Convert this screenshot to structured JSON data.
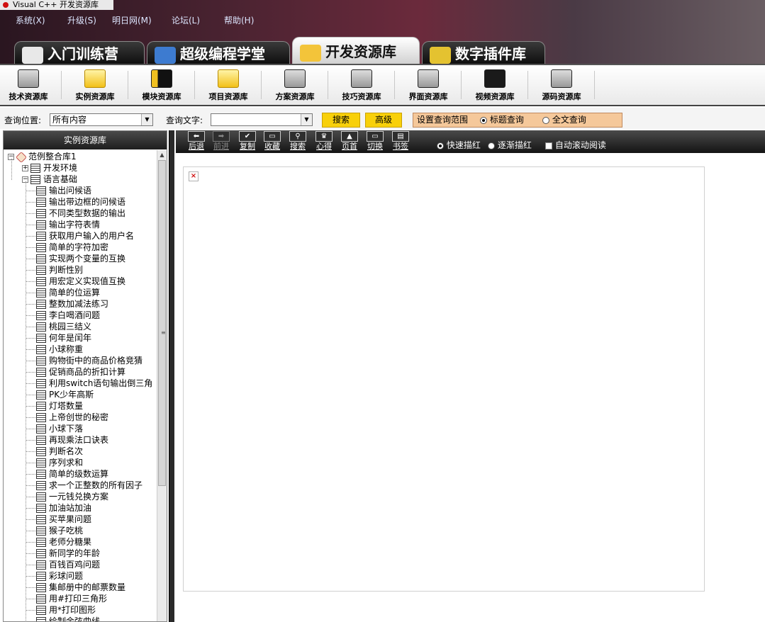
{
  "window": {
    "title": "Visual C++ 开发资源库"
  },
  "menu": [
    "系统(X)",
    "升级(S)",
    "明日网(M)",
    "论坛(L)",
    "帮助(H)"
  ],
  "big_tabs": [
    {
      "label": "入门训练营",
      "active": false
    },
    {
      "label": "超级编程学堂",
      "active": false
    },
    {
      "label": "开发资源库",
      "active": true
    },
    {
      "label": "数字插件库",
      "active": false
    }
  ],
  "libraries": [
    "技术资源库",
    "实例资源库",
    "模块资源库",
    "项目资源库",
    "方案资源库",
    "技巧资源库",
    "界面资源库",
    "视频资源库",
    "源码资源库"
  ],
  "query": {
    "location_label": "查询位置:",
    "location_value": "所有内容",
    "text_label": "查询文字:",
    "text_value": "",
    "search_button": "搜索",
    "advanced_button": "高级",
    "scope_label": "设置查询范围",
    "scope_title": "标题查询",
    "scope_full": "全文查询"
  },
  "left_panel": {
    "header": "实例资源库",
    "root": "范例整合库1",
    "folders": [
      "开发环境",
      "语言基础"
    ],
    "items": [
      "输出问候语",
      "输出带边框的问候语",
      "不同类型数据的输出",
      "输出字符表情",
      "获取用户输入的用户名",
      "简单的字符加密",
      "实现两个变量的互换",
      "判断性别",
      "用宏定义实现值互换",
      "简单的位运算",
      "整数加减法练习",
      "李白喝酒问题",
      "桃园三结义",
      "何年是闰年",
      "小球称重",
      "购物街中的商品价格竞猜",
      "促销商品的折扣计算",
      "利用switch语句输出倒三角",
      "PK少年高斯",
      "灯塔数量",
      "上帝创世的秘密",
      "小球下落",
      "再现乘法口诀表",
      "判断名次",
      "序列求和",
      "简单的级数运算",
      "求一个正整数的所有因子",
      "一元钱兑换方案",
      "加油站加油",
      "买苹果问题",
      "猴子吃桃",
      "老师分糖果",
      "新同学的年龄",
      "百钱百鸡问题",
      "彩球问题",
      "集邮册中的邮票数量",
      "用#打印三角形",
      "用*打印图形",
      "绘制余弦曲线"
    ]
  },
  "nav": {
    "buttons": [
      {
        "label": "后退",
        "icon": "back-arrow-icon",
        "glyph": "⬅",
        "enabled": true
      },
      {
        "label": "前进",
        "icon": "forward-arrow-icon",
        "glyph": "➡",
        "enabled": false
      },
      {
        "label": "复制",
        "icon": "copy-check-icon",
        "glyph": "✔",
        "enabled": true
      },
      {
        "label": "收藏",
        "icon": "favorite-tray-icon",
        "glyph": "▭",
        "enabled": true
      },
      {
        "label": "搜索",
        "icon": "search-icon",
        "glyph": "⚲",
        "enabled": true
      },
      {
        "label": "心得",
        "icon": "notes-crown-icon",
        "glyph": "♛",
        "enabled": true
      },
      {
        "label": "页首",
        "icon": "page-top-icon",
        "glyph": "▲",
        "enabled": true
      },
      {
        "label": "切换",
        "icon": "switch-icon",
        "glyph": "▭",
        "enabled": true
      },
      {
        "label": "书签",
        "icon": "bookmark-icon",
        "glyph": "▤",
        "enabled": true
      }
    ],
    "highlight_quick": "快速描红",
    "highlight_step": "逐渐描红",
    "auto_scroll": "自动滚动阅读"
  },
  "colors": {
    "accent_yellow": "#f8d00a",
    "scope_bg": "#f5c89a",
    "dark_bar": "#1e1e1e"
  }
}
